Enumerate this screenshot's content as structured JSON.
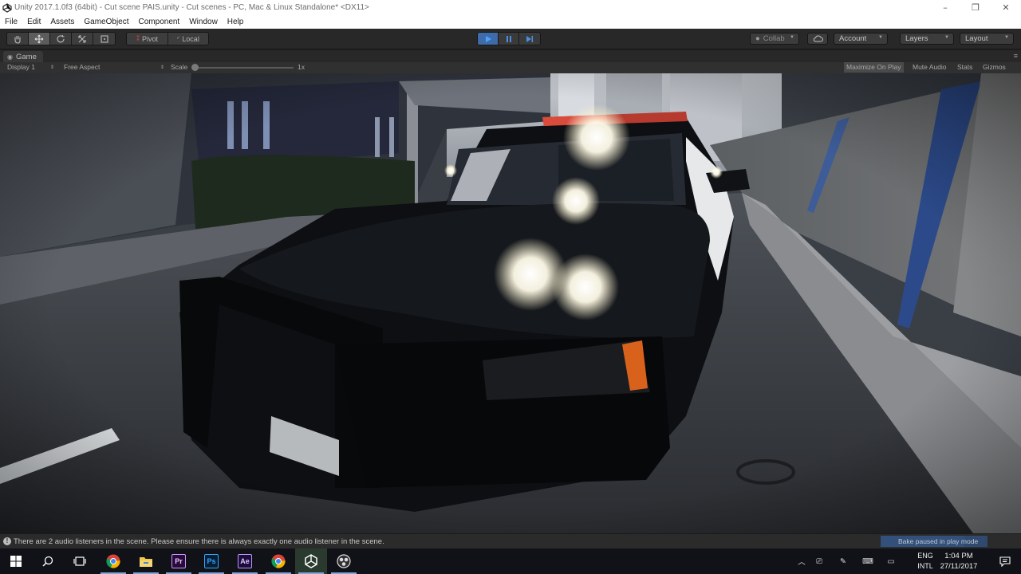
{
  "window": {
    "title": "Unity 2017.1.0f3 (64bit) - Cut scene PAIS.unity - Cut scenes - PC, Mac & Linux Standalone* <DX11>",
    "controls": [
      "–",
      "❐",
      "✕"
    ]
  },
  "menu": [
    "File",
    "Edit",
    "Assets",
    "GameObject",
    "Component",
    "Window",
    "Help"
  ],
  "toolbar": {
    "tools": [
      "hand-icon",
      "move-icon",
      "rotate-icon",
      "scale-icon",
      "rect-icon"
    ],
    "pivot_label": "Pivot",
    "local_label": "Local",
    "collab_label": "Collab",
    "account_label": "Account",
    "layers_label": "Layers",
    "layout_label": "Layout"
  },
  "game_tab": {
    "label": "Game",
    "display": "Display 1",
    "aspect": "Free Aspect",
    "scale_label": "Scale",
    "scale_value": "1x",
    "maximize": "Maximize On Play",
    "mute": "Mute Audio",
    "stats": "Stats",
    "gizmos": "Gizmos"
  },
  "status": {
    "message": "There are 2 audio listeners in the scene. Please ensure there is always exactly one audio listener in the scene.",
    "bake": "Bake paused in play mode"
  },
  "taskbar": {
    "apps": [
      "windows-start-icon",
      "search-icon",
      "task-view-icon",
      "chrome-icon",
      "file-explorer-icon",
      "premiere-icon",
      "photoshop-icon",
      "after-effects-icon",
      "chrome-icon",
      "unity-icon",
      "obs-icon"
    ],
    "premiere_text": "Pr",
    "photoshop_text": "Ps",
    "after_effects_text": "Ae",
    "lang_top": "ENG",
    "lang_bottom": "INTL",
    "time": "1:04 PM",
    "date": "27/11/2017"
  }
}
